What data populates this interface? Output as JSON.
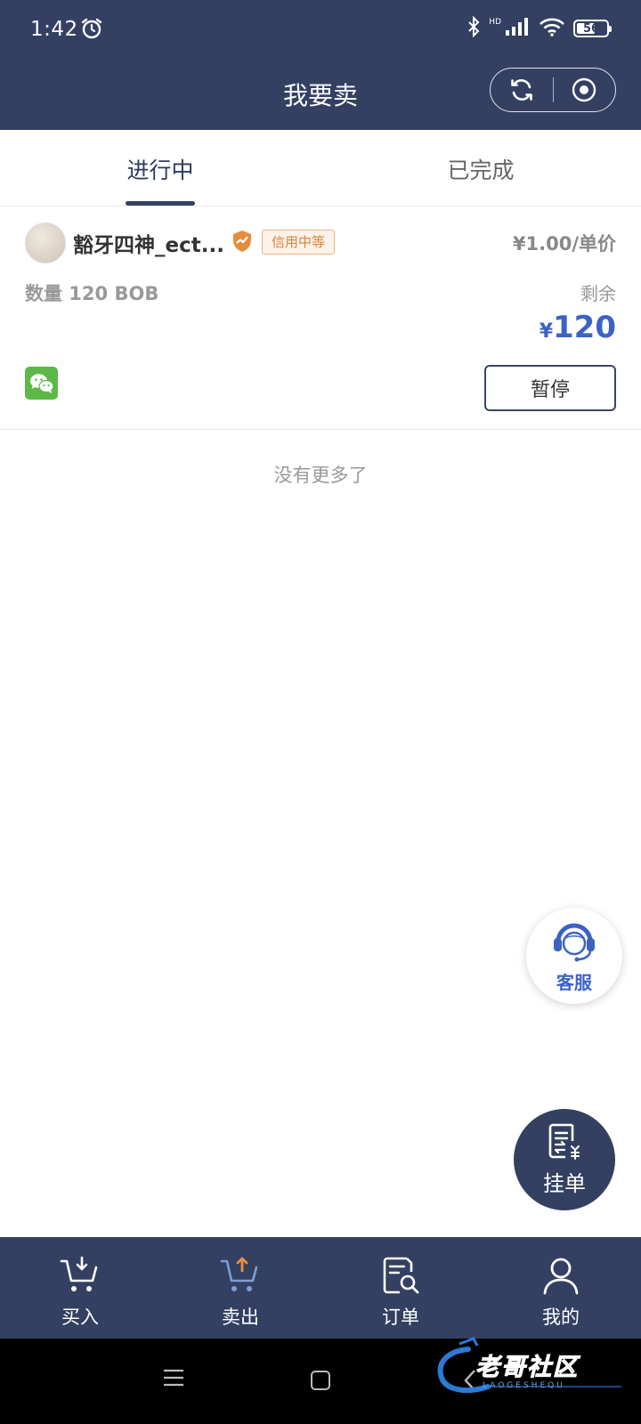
{
  "status_bar": {
    "time": "1:42",
    "battery": "56",
    "network_badge": "HD"
  },
  "header": {
    "title": "我要卖"
  },
  "tabs": [
    {
      "label": "进行中",
      "active": true
    },
    {
      "label": "已完成",
      "active": false
    }
  ],
  "order": {
    "username": "豁牙四神_ect...",
    "credit_badge": "信用中等",
    "price": "¥1.00/单价",
    "quantity": "数量  120  BOB",
    "remaining_label": "剩余",
    "remaining_currency": "¥",
    "remaining_value": "120",
    "payment_icon": "wechat-icon",
    "pause_label": "暂停"
  },
  "list_end_text": "没有更多了",
  "float_service": {
    "label": "客服"
  },
  "float_post": {
    "label": "挂单"
  },
  "bottom_nav": [
    {
      "label": "买入",
      "icon": "cart-down-icon",
      "active": false
    },
    {
      "label": "卖出",
      "icon": "cart-up-icon",
      "active": true
    },
    {
      "label": "订单",
      "icon": "order-search-icon",
      "active": false
    },
    {
      "label": "我的",
      "icon": "user-icon",
      "active": false
    }
  ],
  "watermark": {
    "text": "老哥社区",
    "sub": "LAOGESHEQU"
  },
  "colors": {
    "primary": "#334062",
    "accent_blue": "#3b62c4",
    "orange": "#e07f34",
    "upload_arrow": "#f08a3a",
    "wechat": "#5cb847"
  }
}
